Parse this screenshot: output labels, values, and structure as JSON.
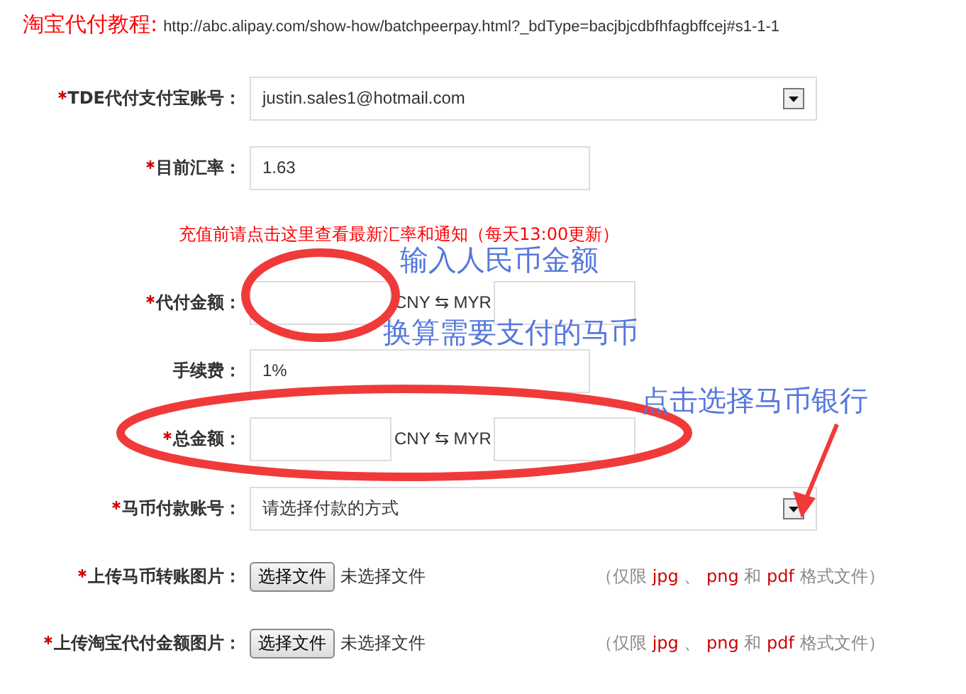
{
  "header": {
    "title": "淘宝代付教程:",
    "url": "http://abc.alipay.com/show-how/batchpeerpay.html?_bdType=bacjbjcdbfhfagbffcej#s1-1-1"
  },
  "rows": [
    {
      "kind": "select",
      "label": "TDE代付支付宝账号：",
      "required": true,
      "value": "justin.sales1@hotmail.com"
    },
    {
      "kind": "text",
      "label": "目前汇率：",
      "required": true,
      "value": "1.63"
    },
    {
      "kind": "notice",
      "text": "充值前请点击这里查看最新汇率和通知（每天13:00更新）"
    },
    {
      "kind": "pair",
      "label": "代付金额：",
      "required": true,
      "middle": "CNY ⇆ MYR"
    },
    {
      "kind": "text",
      "label": "手续费：",
      "required": false,
      "value": "1%"
    },
    {
      "kind": "pair",
      "label": "总金额：",
      "required": true,
      "middle": "CNY ⇆ MYR"
    },
    {
      "kind": "select",
      "label": "马币付款账号：",
      "required": true,
      "value": "请选择付款的方式"
    },
    {
      "kind": "file",
      "label": "上传马币转账图片：",
      "required": true,
      "button": "选择文件",
      "status": "未选择文件",
      "hint": [
        {
          "text": "（仅限 ",
          "kind": "plain"
        },
        {
          "text": "jpg",
          "kind": "format"
        },
        {
          "text": " 、 ",
          "kind": "plain"
        },
        {
          "text": "png",
          "kind": "format"
        },
        {
          "text": " 和 ",
          "kind": "plain"
        },
        {
          "text": "pdf",
          "kind": "format"
        },
        {
          "text": " 格式文件）",
          "kind": "plain"
        }
      ]
    },
    {
      "kind": "file",
      "label": "上传淘宝代付金额图片：",
      "required": true,
      "button": "选择文件",
      "status": "未选择文件",
      "hint": [
        {
          "text": "（仅限 ",
          "kind": "plain"
        },
        {
          "text": "jpg",
          "kind": "format"
        },
        {
          "text": " 、 ",
          "kind": "plain"
        },
        {
          "text": "png",
          "kind": "format"
        },
        {
          "text": " 和 ",
          "kind": "plain"
        },
        {
          "text": "pdf",
          "kind": "format"
        },
        {
          "text": " 格式文件）",
          "kind": "plain"
        }
      ]
    }
  ],
  "annotations": [
    "输入人民币金额",
    "换算需要支付的马币",
    "点击选择马币银行"
  ]
}
